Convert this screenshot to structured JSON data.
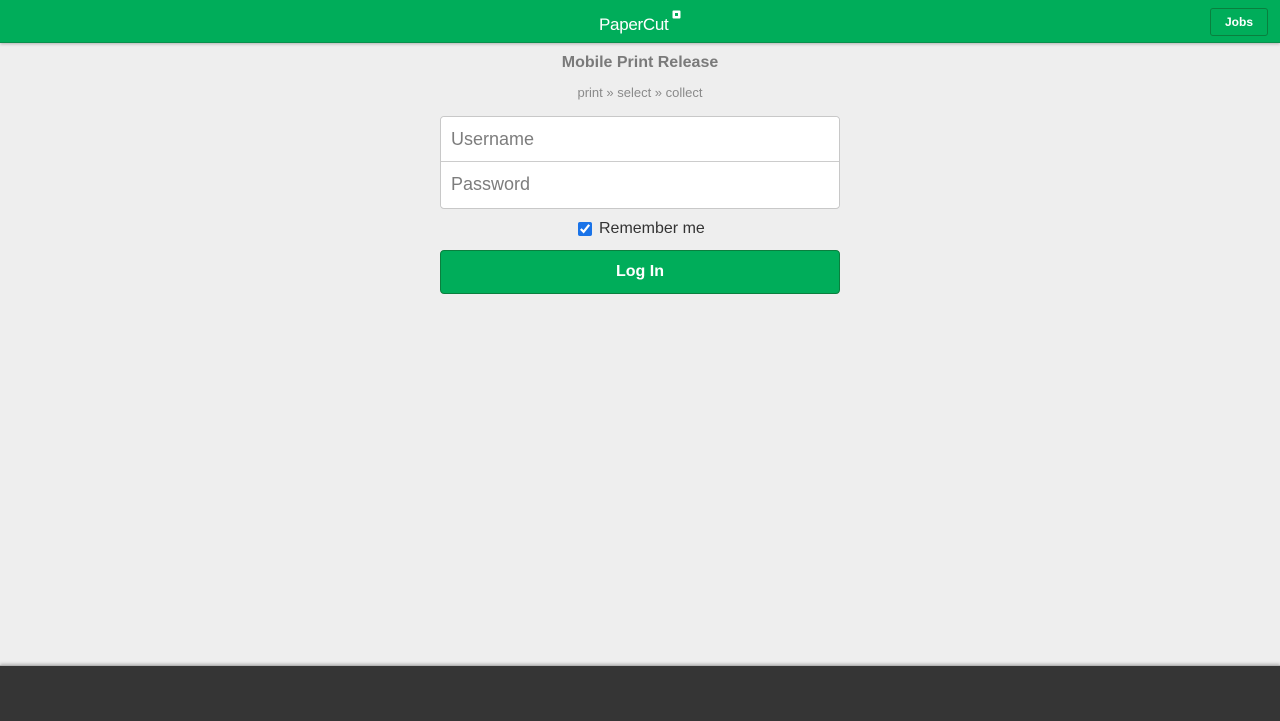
{
  "header": {
    "logo_text": "PaperCut",
    "logo_icon": "papercut-logo-mark-icon",
    "jobs_label": "Jobs"
  },
  "main": {
    "title": "Mobile Print Release",
    "subtitle": "print » select » collect",
    "username_placeholder": "Username",
    "username_value": "",
    "password_placeholder": "Password",
    "password_value": "",
    "remember_label": "Remember me",
    "remember_checked": true,
    "login_label": "Log In"
  },
  "colors": {
    "brand_green": "#00ad5a",
    "background": "#eeeeee",
    "footer": "#353535",
    "checkbox_accent": "#1a73e8"
  }
}
